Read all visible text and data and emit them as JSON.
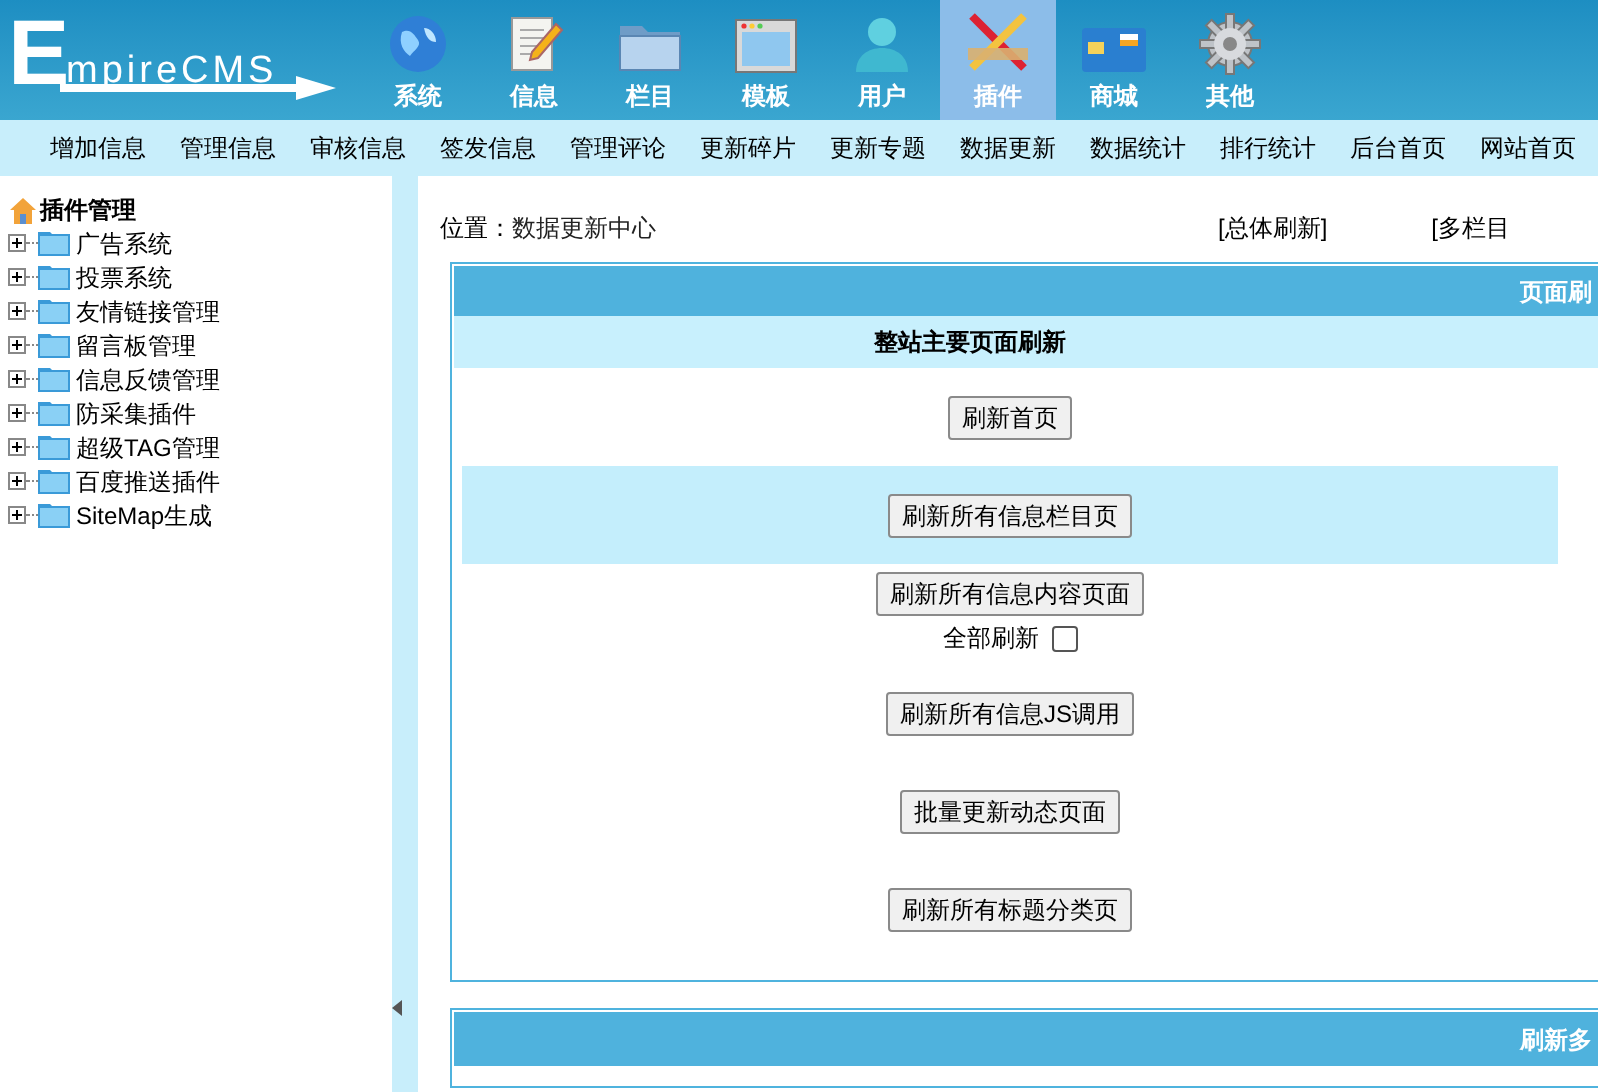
{
  "logo": {
    "initial": "E",
    "rest": "mpireCMS"
  },
  "nav_tabs": [
    {
      "label": "系统",
      "selected": false
    },
    {
      "label": "信息",
      "selected": false
    },
    {
      "label": "栏目",
      "selected": false
    },
    {
      "label": "模板",
      "selected": false
    },
    {
      "label": "用户",
      "selected": false
    },
    {
      "label": "插件",
      "selected": true
    },
    {
      "label": "商城",
      "selected": false
    },
    {
      "label": "其他",
      "selected": false
    }
  ],
  "sub_menu": [
    "增加信息",
    "管理信息",
    "审核信息",
    "签发信息",
    "管理评论",
    "更新碎片",
    "更新专题",
    "数据更新",
    "数据统计",
    "排行统计",
    "后台首页",
    "网站首页"
  ],
  "sidebar": {
    "title": "插件管理",
    "items": [
      {
        "label": "广告系统",
        "expanded": false
      },
      {
        "label": "投票系统",
        "expanded": false
      },
      {
        "label": "友情链接管理",
        "expanded": false
      },
      {
        "label": "留言板管理",
        "expanded": false
      },
      {
        "label": "信息反馈管理",
        "expanded": false
      },
      {
        "label": "防采集插件",
        "expanded": false
      },
      {
        "label": "超级TAG管理",
        "expanded": false
      },
      {
        "label": "百度推送插件",
        "expanded": false
      },
      {
        "label": "SiteMap生成",
        "expanded": false
      }
    ]
  },
  "location": {
    "label": "位置：",
    "path": "数据更新中心"
  },
  "top_links": [
    "[总体刷新]",
    "[多栏目"
  ],
  "panel": {
    "header": "页面刷",
    "subheader": "整站主要页面刷新",
    "rows": [
      {
        "button": "刷新首页",
        "highlighted": false
      },
      {
        "button": "刷新所有信息栏目页",
        "highlighted": true
      },
      {
        "button": "刷新所有信息内容页面",
        "highlighted": false,
        "option": {
          "label": "全部刷新",
          "checked": false
        }
      },
      {
        "button": "刷新所有信息JS调用",
        "highlighted": false
      },
      {
        "button": "批量更新动态页面",
        "highlighted": false
      },
      {
        "button": "刷新所有标题分类页",
        "highlighted": false
      }
    ]
  },
  "panel_2": {
    "header": "刷新多"
  }
}
